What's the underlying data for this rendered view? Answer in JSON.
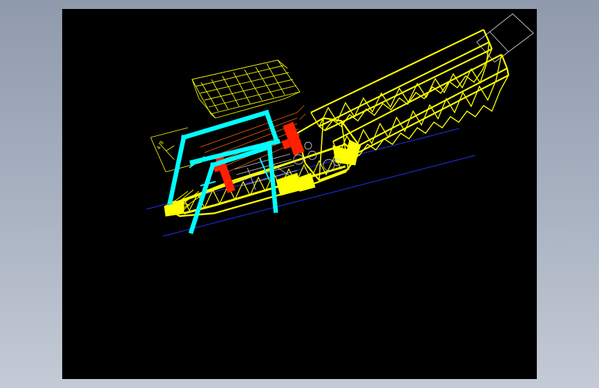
{
  "colors": {
    "outer_background": "#a4aebd",
    "viewport_background": "#000000",
    "truss": "#ffff00",
    "gantry": "#00ffff",
    "highlight": "#ff2000",
    "rails": "#1c2bd0",
    "bounding_box": "#d8d8d8"
  },
  "viewport": {
    "kind": "cad-3d-wireframe",
    "subject": "",
    "icons": [
      "wireframe-model"
    ]
  },
  "labels": {
    "dimension_text": "4.8"
  }
}
